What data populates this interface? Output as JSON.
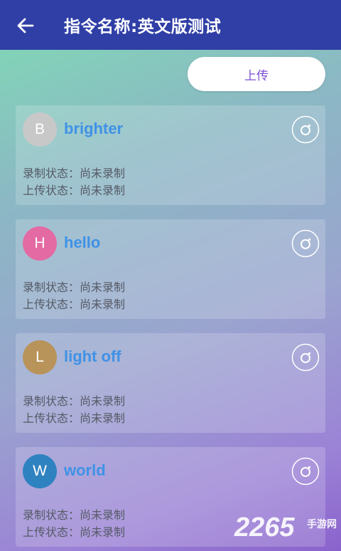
{
  "header": {
    "title": "指令名称:英文版测试",
    "back_icon": "arrow-left-icon"
  },
  "upload_button": {
    "label": "上传"
  },
  "status_labels": {
    "record_prefix": "录制状态：",
    "upload_prefix": "上传状态："
  },
  "commands": [
    {
      "initial": "B",
      "name": "brighter",
      "avatar_color": "#c8c8c8",
      "record_status": "录制状态：尚未录制",
      "upload_status": "上传状态：尚未录制"
    },
    {
      "initial": "H",
      "name": "hello",
      "avatar_color": "#e46aa3",
      "record_status": "录制状态：尚未录制",
      "upload_status": "上传状态：尚未录制"
    },
    {
      "initial": "L",
      "name": "light off",
      "avatar_color": "#b8935a",
      "record_status": "录制状态：尚未录制",
      "upload_status": "上传状态：尚未录制"
    },
    {
      "initial": "W",
      "name": "world",
      "avatar_color": "#2f82c0",
      "record_status": "录制状态：尚未录制",
      "upload_status": "上传状态：尚未录制"
    }
  ],
  "record_icon": "record-button-icon",
  "watermark": {
    "number": "2265",
    "text": "手游网"
  }
}
